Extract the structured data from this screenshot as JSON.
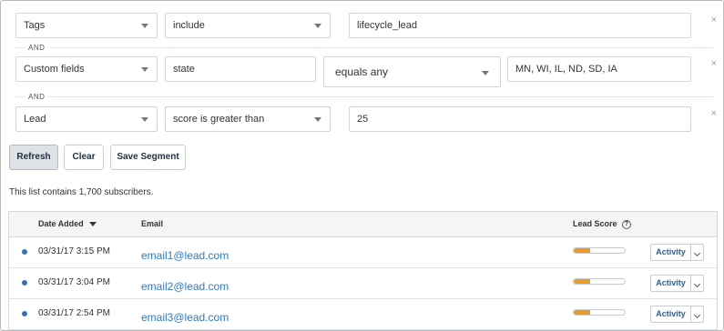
{
  "filters": [
    {
      "field": "Tags",
      "operator": "include",
      "value": "lifecycle_lead"
    },
    {
      "field": "Custom fields",
      "subfield": "state",
      "operator": "equals any",
      "value": "MN, WI, IL, ND, SD, IA"
    },
    {
      "field": "Lead",
      "operator": "score is greater than",
      "value": "25"
    }
  ],
  "connector": "AND",
  "remove_icon": "×",
  "actions": {
    "refresh": "Refresh",
    "clear": "Clear",
    "save_segment": "Save Segment"
  },
  "subscriber_count_text": "This list contains 1,700 subscribers.",
  "table": {
    "headers": {
      "date_added": "Date Added",
      "email": "Email",
      "lead_score": "Lead Score",
      "help": "?"
    },
    "rows": [
      {
        "date": "03/31/17 3:15 PM",
        "email": "email1@lead.com",
        "score_fraction": 0.33,
        "action": "Activity"
      },
      {
        "date": "03/31/17 3:04 PM",
        "email": "email2@lead.com",
        "score_fraction": 0.33,
        "action": "Activity"
      },
      {
        "date": "03/31/17 2:54 PM",
        "email": "email3@lead.com",
        "score_fraction": 0.33,
        "action": "Activity"
      }
    ]
  },
  "colors": {
    "link": "#2f7bbf",
    "score_fill": "#e89c2c",
    "status_dot": "#3a72b8"
  }
}
